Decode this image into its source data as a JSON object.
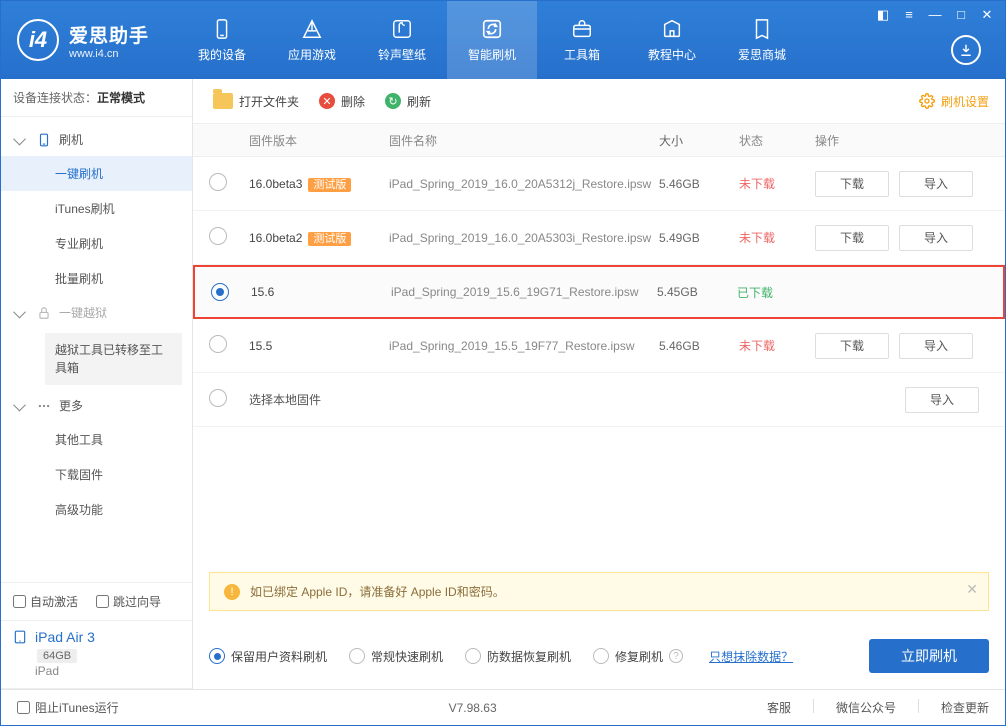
{
  "app": {
    "title": "爱思助手",
    "subtitle": "www.i4.cn"
  },
  "topnav": [
    {
      "label": "我的设备"
    },
    {
      "label": "应用游戏"
    },
    {
      "label": "铃声壁纸"
    },
    {
      "label": "智能刷机",
      "active": true
    },
    {
      "label": "工具箱"
    },
    {
      "label": "教程中心"
    },
    {
      "label": "爱思商城"
    }
  ],
  "sidebar": {
    "status_prefix": "设备连接状态：",
    "status_value": "正常模式",
    "groups": {
      "flash": {
        "label": "刷机",
        "items": [
          "一键刷机",
          "iTunes刷机",
          "专业刷机",
          "批量刷机"
        ],
        "active_index": 0
      },
      "jailbreak": {
        "label": "一键越狱",
        "note": "越狱工具已转移至工具箱"
      },
      "more": {
        "label": "更多",
        "items": [
          "其他工具",
          "下载固件",
          "高级功能"
        ]
      }
    },
    "auto_activate": "自动激活",
    "skip_wizard": "跳过向导",
    "device_name": "iPad Air 3",
    "device_storage": "64GB",
    "device_type": "iPad"
  },
  "toolbar": {
    "open_folder": "打开文件夹",
    "delete": "删除",
    "refresh": "刷新",
    "settings": "刷机设置"
  },
  "table": {
    "headers": {
      "version": "固件版本",
      "name": "固件名称",
      "size": "大小",
      "status": "状态",
      "ops": "操作"
    },
    "download": "下载",
    "import": "导入",
    "select_local": "选择本地固件",
    "rows": [
      {
        "version": "16.0beta3",
        "beta": "测试版",
        "name": "iPad_Spring_2019_16.0_20A5312j_Restore.ipsw",
        "size": "5.46GB",
        "status": "未下载",
        "status_cls": "status-not",
        "selected": false,
        "highlight": false,
        "show_ops": true
      },
      {
        "version": "16.0beta2",
        "beta": "测试版",
        "name": "iPad_Spring_2019_16.0_20A5303i_Restore.ipsw",
        "size": "5.49GB",
        "status": "未下载",
        "status_cls": "status-not",
        "selected": false,
        "highlight": false,
        "show_ops": true
      },
      {
        "version": "15.6",
        "beta": "",
        "name": "iPad_Spring_2019_15.6_19G71_Restore.ipsw",
        "size": "5.45GB",
        "status": "已下载",
        "status_cls": "status-ok",
        "selected": true,
        "highlight": true,
        "show_ops": false
      },
      {
        "version": "15.5",
        "beta": "",
        "name": "iPad_Spring_2019_15.5_19F77_Restore.ipsw",
        "size": "5.46GB",
        "status": "未下载",
        "status_cls": "status-not",
        "selected": false,
        "highlight": false,
        "show_ops": true
      }
    ]
  },
  "notice": "如已绑定 Apple ID，请准备好 Apple ID和密码。",
  "options": {
    "keep_data": "保留用户资料刷机",
    "normal": "常规快速刷机",
    "anti_data": "防数据恢复刷机",
    "repair": "修复刷机",
    "erase_only": "只想抹除数据？",
    "start": "立即刷机"
  },
  "footer": {
    "block_itunes": "阻止iTunes运行",
    "version": "V7.98.63",
    "support": "客服",
    "wechat": "微信公众号",
    "check_update": "检查更新"
  }
}
